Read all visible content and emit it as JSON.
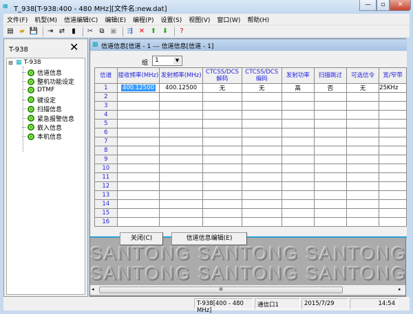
{
  "window": {
    "title": "T_938[T-938:400 - 480 MHz][文件名:new.dat]",
    "minimize": "—",
    "maximize": "▫",
    "close": "✕"
  },
  "menu": [
    "文件(F)",
    "机型(M)",
    "信道编辑(C)",
    "编辑(E)",
    "编程(P)",
    "设置(S)",
    "视图(V)",
    "窗口(W)",
    "帮助(H)"
  ],
  "left_panel": {
    "title": "T-938",
    "root": "T-938",
    "items": [
      "信道信息",
      "整机功能设定",
      "DTMF",
      "键设定",
      "扫描信息",
      "紧急报警信息",
      "嵌入信息",
      "本机信息"
    ]
  },
  "child": {
    "title": "信道信息[信道 - 1 --- 信道信息[信道 - 1]",
    "group_label": "组",
    "group_value": "1",
    "columns": [
      "信道",
      "接收频率(MHz)",
      "发射频率(MHz)",
      "CTCSS/DCS 解码",
      "CTCSS/DCS 编码",
      "发射功率",
      "扫描跳过",
      "可选信令",
      "宽/窄带"
    ],
    "rows": [
      [
        "1",
        "400.12500",
        "400.12500",
        "无",
        "无",
        "高",
        "否",
        "无",
        "25KHz"
      ],
      [
        "2"
      ],
      [
        "3"
      ],
      [
        "4"
      ],
      [
        "5"
      ],
      [
        "6"
      ],
      [
        "7"
      ],
      [
        "8"
      ],
      [
        "9"
      ],
      [
        "10"
      ],
      [
        "11"
      ],
      [
        "12"
      ],
      [
        "13"
      ],
      [
        "14"
      ],
      [
        "15"
      ],
      [
        "16"
      ]
    ],
    "close_button": "关闭(C)",
    "edit_button": "信道信息编辑(E)"
  },
  "watermark": "SANTONG",
  "scroll_grip": "III",
  "status": [
    "T-938[400 - 480 MHz]",
    "通信口1",
    "2015/7/29",
    "14:54"
  ]
}
